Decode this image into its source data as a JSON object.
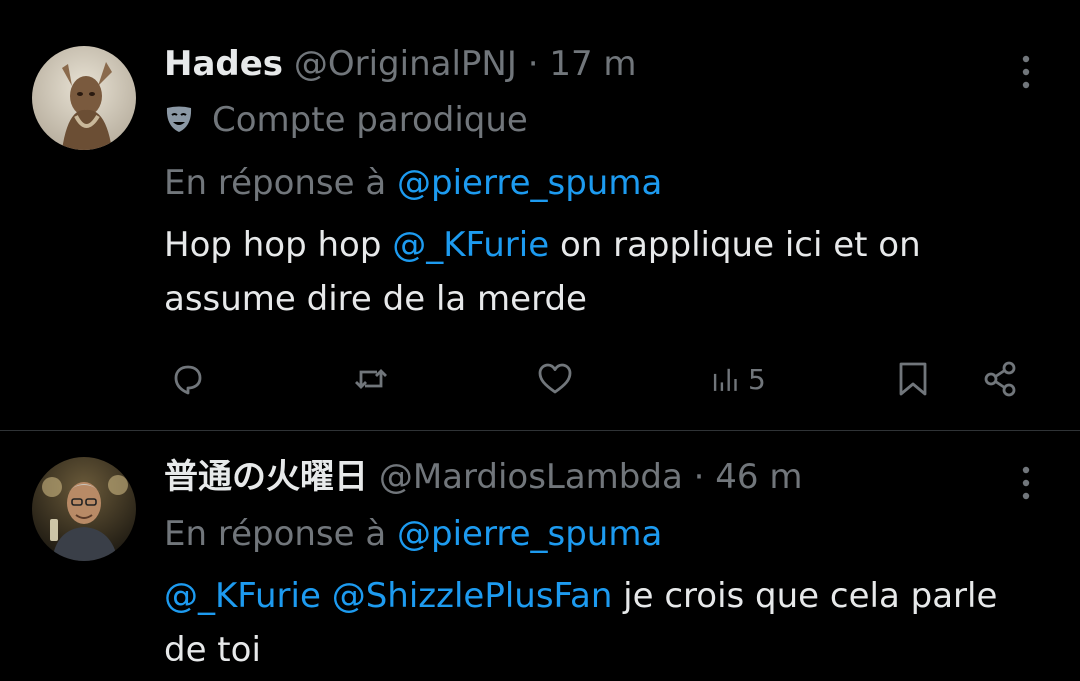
{
  "tweets": [
    {
      "name": "Hades",
      "handle": "@OriginalPNJ",
      "separator": "·",
      "time": "17 m",
      "badge": {
        "icon": "parody-mask-icon",
        "label": "Compte parodique"
      },
      "reply_prefix": "En réponse à",
      "reply_to": "@pierre_spuma",
      "body": {
        "part1": "Hop hop hop ",
        "mention1": "@_KFurie",
        "part2": " on rapplique ici et on assume dire de la merde"
      },
      "actions": {
        "reply_icon": "reply-icon",
        "retweet_icon": "retweet-icon",
        "like_icon": "heart-icon",
        "views_icon": "views-icon",
        "views": "5",
        "bookmark_icon": "bookmark-icon",
        "share_icon": "share-icon"
      }
    },
    {
      "name": "普通の火曜日",
      "handle": "@MardiosLambda",
      "separator": "·",
      "time": "46 m",
      "reply_prefix": "En réponse à",
      "reply_to": "@pierre_spuma",
      "body": {
        "mention1": "@_KFurie",
        "mention2": "@ShizzlePlusFan",
        "part1": " je crois que cela parle de toi"
      }
    }
  ],
  "colors": {
    "background": "#000000",
    "text": "#e7e9ea",
    "muted": "#71767b",
    "link": "#1d9bf0",
    "divider": "#2f3336"
  }
}
